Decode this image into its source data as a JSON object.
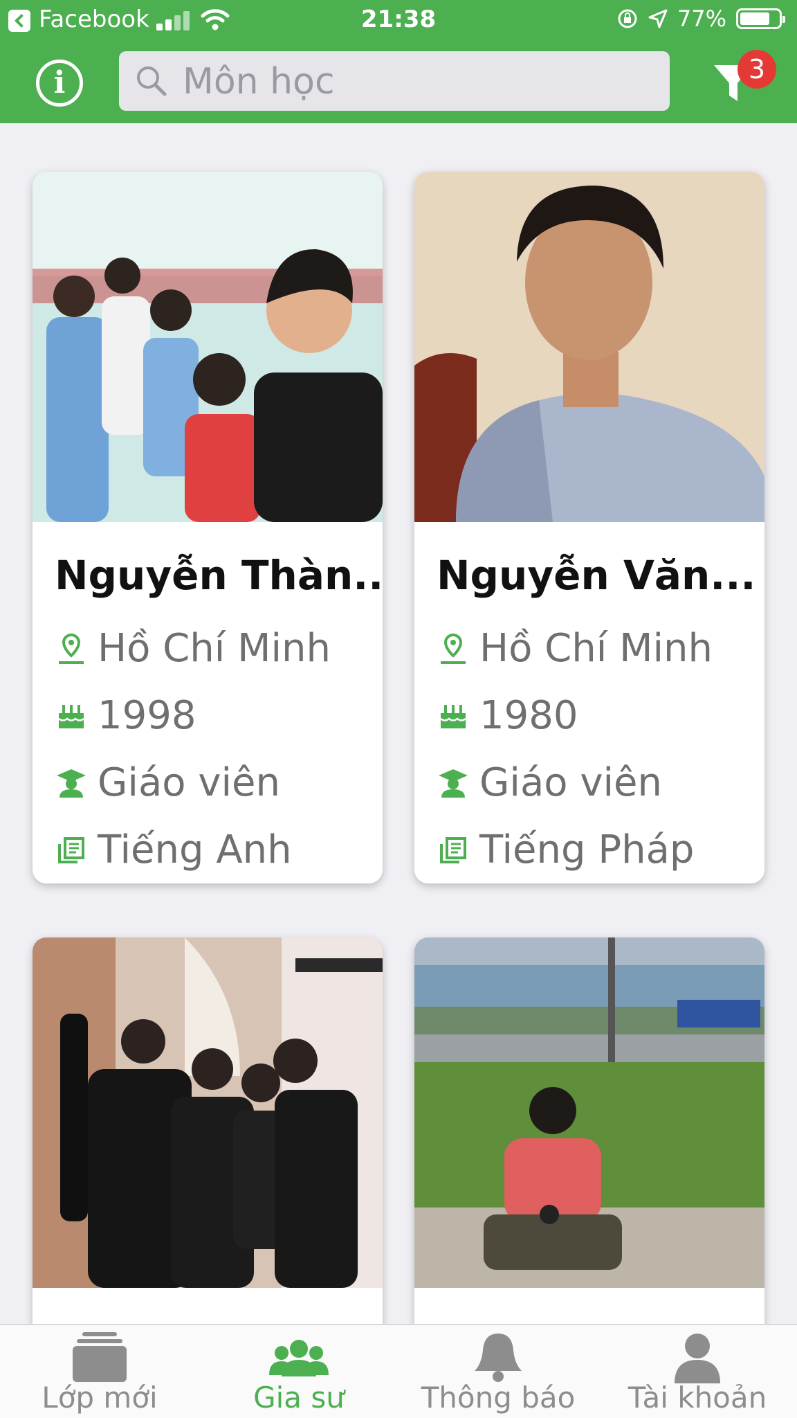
{
  "status_bar": {
    "back_app": "Facebook",
    "time": "21:38",
    "battery": "77%",
    "battery_level": 0.77
  },
  "header": {
    "info_icon": "info-circle-icon",
    "search_placeholder": "Môn học",
    "filter_icon": "filter-icon",
    "filter_count": "3"
  },
  "tutors": [
    {
      "name": "Nguyễn Thàn...",
      "location": "Hồ Chí Minh",
      "birth_year": "1998",
      "occupation": "Giáo viên",
      "subject": "Tiếng Anh"
    },
    {
      "name": "Nguyễn Văn...",
      "location": "Hồ Chí Minh",
      "birth_year": "1980",
      "occupation": "Giáo viên",
      "subject": "Tiếng Pháp"
    },
    {
      "name": "",
      "location": "",
      "birth_year": "",
      "occupation": "",
      "subject": ""
    },
    {
      "name": "",
      "location": "",
      "birth_year": "",
      "occupation": "",
      "subject": ""
    }
  ],
  "tabs": [
    {
      "label": "Lớp mới",
      "icon": "classes-icon",
      "active": false
    },
    {
      "label": "Gia sư",
      "icon": "tutors-group-icon",
      "active": true
    },
    {
      "label": "Thông báo",
      "icon": "bell-icon",
      "active": false
    },
    {
      "label": "Tài khoản",
      "icon": "account-icon",
      "active": false
    }
  ],
  "colors": {
    "brand": "#4caf50",
    "badge": "#e53935",
    "inactive_tab": "#8d8d8d"
  }
}
